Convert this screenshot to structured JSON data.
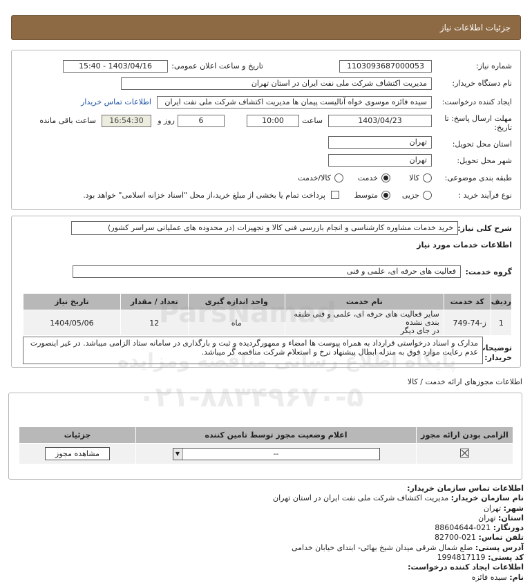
{
  "header": {
    "title": "جزئیات اطلاعات نیاز"
  },
  "need": {
    "need_number_label": "شماره نیاز:",
    "need_number": "1103093687000053",
    "announce_label": "تاریخ و ساعت اعلان عمومی:",
    "announce_value": "1403/04/16 - 15:40",
    "buyer_org_label": "نام دستگاه خریدار:",
    "buyer_org": "مدیریت اکتشاف شرکت ملی نفت ایران در استان تهران",
    "requester_label": "ایجاد کننده درخواست:",
    "requester": "سیده فائزه موسوی خواه آنالیست پیمان ها مدیریت اکتشاف شرکت ملی نفت ایران",
    "contact_link": "اطلاعات تماس خریدار",
    "deadline_label_1": "مهلت ارسال پاسخ: تا",
    "deadline_label_2": "تاریخ:",
    "deadline_date": "1403/04/23",
    "time_label": "ساعت",
    "deadline_time": "10:00",
    "days_value": "6",
    "days_label": "روز و",
    "remaining_time": "16:54:30",
    "remaining_label": "ساعت باقی مانده",
    "province_label": "استان محل تحویل:",
    "province": "تهران",
    "city_label": "شهر محل تحویل:",
    "city": "تهران",
    "category_label": "طبقه بندی موضوعی:",
    "category_options": [
      "کالا",
      "خدمت",
      "کالا/خدمت"
    ],
    "process_label": "نوع فرآیند خرید :",
    "process_options": [
      "جزیی",
      "متوسط"
    ],
    "payment_note": "پرداخت تمام یا بخشی از مبلغ خرید،از محل \"اسناد خزانه اسلامی\" خواهد بود."
  },
  "summary": {
    "label": "شرح کلی نیاز:",
    "value": "خرید خدمات مشاوره کارشناسی و انجام بازرسی فنی کالا و تجهیزات (در محدوده های عملیاتی سراسر کشور)",
    "services_title": "اطلاعات خدمات مورد نیاز",
    "service_group_label": "گروه خدمت:",
    "service_group": "فعالیت های حرفه ای، علمی و فنی"
  },
  "items_table": {
    "headers": [
      "ردیف",
      "کد خدمت",
      "نام خدمت",
      "واحد اندازه گیری",
      "تعداد / مقدار",
      "تاریخ نیاز"
    ],
    "rows": [
      {
        "row": "1",
        "code": "ز-74-749",
        "name_line1": "سایر فعالیت های حرفه ای، علمی و فنی طبقه بندی نشده",
        "name_line2": "در جای دیگر",
        "unit": "ماه",
        "qty": "12",
        "date": "1404/05/06"
      }
    ]
  },
  "buyer_notes": {
    "label_1": "توضیحات",
    "label_2": "خریدار:",
    "text": "مدارک و اسناد درخواستی قرارداد به همراه پیوست ها امضاء و ممهورگردیده و ثبت و بارگذاری در سامانه ستاد الزامی میباشد. در غیر اینصورت عدم رعایت موارد فوق به منزله ابطال پیشنهاد نرخ و استعلام شرکت مناقصه گر میباشد."
  },
  "permits": {
    "title": "اطلاعات مجوزهای ارائه خدمت / کالا",
    "headers": [
      "الزامی بودن ارائه مجوز",
      "اعلام وضعیت مجوز توسط تامین کننده",
      "جزئیات"
    ],
    "status_value": "--",
    "view_button": "مشاهده مجوز"
  },
  "contact": {
    "title": "اطلاعات تماس سازمان خریدار:",
    "org_label": "نام سازمان خریدار:",
    "org": "مدیریت اکتشاف شرکت ملی نفت ایران در استان تهران",
    "city_label": "شهر:",
    "city": "تهران",
    "province_label": "استان:",
    "province": "تهران",
    "fax_label": "دورنگار:",
    "fax": "021-88604644",
    "phone_label": "تلفن تماس:",
    "phone": "021-82700",
    "address_label": "آدرس پستی:",
    "address": "ضلع شمال شرقی میدان شیخ بهائی- ابتدای خیابان خدامی",
    "postal_label": "کد پستی:",
    "postal": "1994817119",
    "creator_title": "اطلاعات ایجاد کننده درخواست:",
    "name_label": "نام:",
    "name": "سیده فائزه"
  },
  "watermark": {
    "line1": "پایگاه اطلاع رسانی مناقصه ومزایده",
    "line2": "۰۲۱-۸۸۳۴۹۶۷۰-۵",
    "brand": "ParsNamad"
  }
}
